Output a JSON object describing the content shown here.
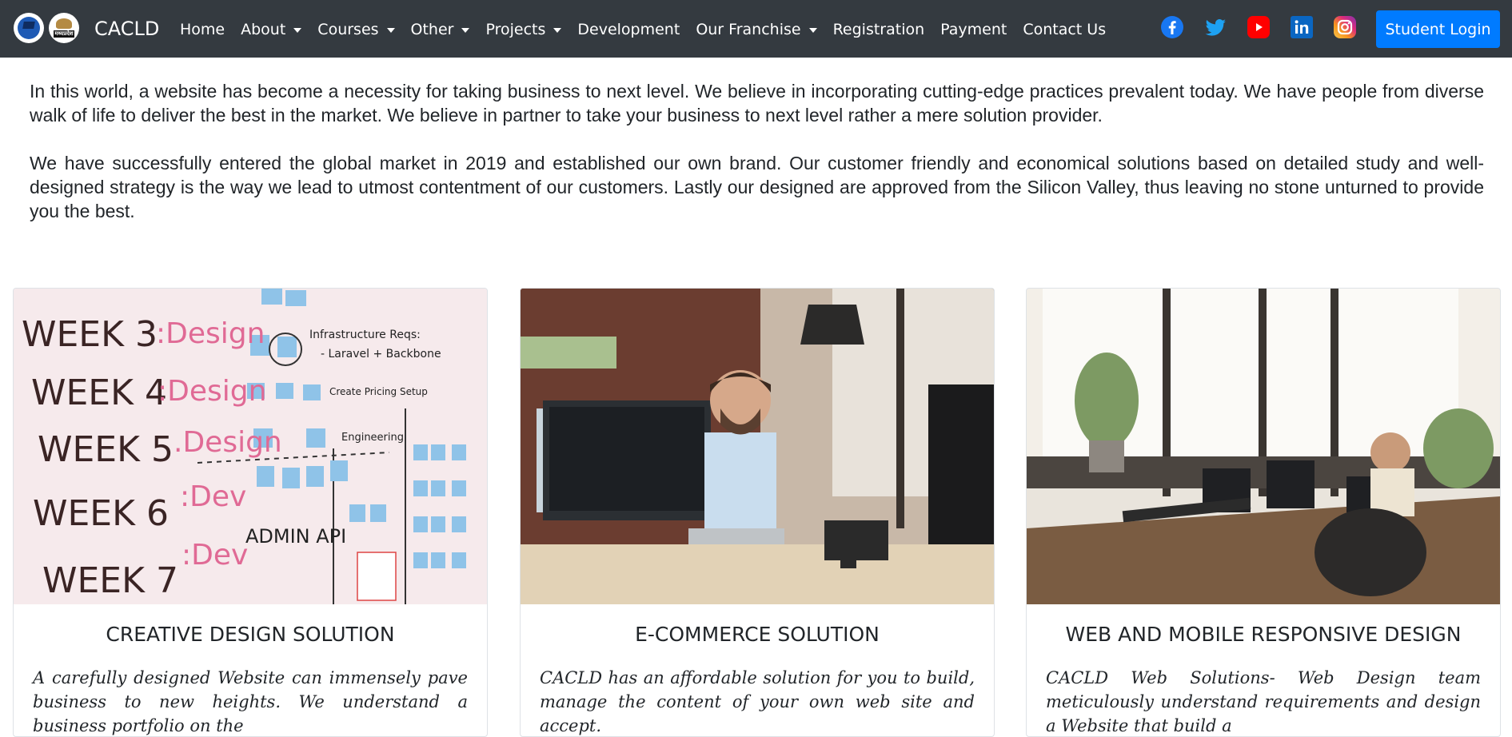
{
  "navbar": {
    "logos": {
      "second_logo_text": "मध्यप्रदेश"
    },
    "brand": "CACLD",
    "items": [
      {
        "label": "Home",
        "dropdown": false
      },
      {
        "label": "About",
        "dropdown": true
      },
      {
        "label": "Courses",
        "dropdown": true
      },
      {
        "label": "Other",
        "dropdown": true
      },
      {
        "label": "Projects",
        "dropdown": true
      },
      {
        "label": "Development",
        "dropdown": false
      },
      {
        "label": "Our Franchise",
        "dropdown": true
      },
      {
        "label": "Registration",
        "dropdown": false
      },
      {
        "label": "Payment",
        "dropdown": false
      },
      {
        "label": "Contact Us",
        "dropdown": false
      }
    ],
    "socials": [
      "facebook-icon",
      "twitter-icon",
      "youtube-icon",
      "linkedin-icon",
      "instagram-icon"
    ],
    "login_label": "Student Login"
  },
  "intro": {
    "p1": "In this world, a website has become a necessity for taking business to next level. We believe in incorporating cutting-edge practices prevalent today. We have people from diverse walk of life to deliver the best in the market. We believe in partner to take your business to next level rather a mere solution provider.",
    "p2": "We have successfully entered the global market in 2019 and established our own brand. Our customer friendly and economical solutions based on detailed study and well-designed strategy is the way we lead to utmost contentment of our customers. Lastly our designed are approved from the Silicon Valley, thus leaving no stone unturned to provide you the best."
  },
  "cards": [
    {
      "title": "CREATIVE DESIGN SOLUTION",
      "text": "A carefully designed Website can immensely pave business to new heights. We understand a business portfolio on the",
      "image": {
        "whiteboard_rows": [
          {
            "label": "WEEK 3",
            "tag": ":Design"
          },
          {
            "label": "WEEK 4",
            "tag": ":Design"
          },
          {
            "label": "WEEK 5",
            "tag": ".Design"
          },
          {
            "label": "WEEK 6",
            "tag": ":Dev"
          },
          {
            "label": "WEEK 7",
            "tag": ":Dev"
          }
        ],
        "notes": {
          "infra": "Infrastructure Reqs:",
          "infra2": "- Laravel + Backbone",
          "create": "Create Pricing Setup",
          "engineering": "Engineering",
          "admin": "ADMIN API"
        }
      }
    },
    {
      "title": "E-COMMERCE SOLUTION",
      "text": "CACLD has an affordable solution for you to build, manage the content of your own web site and accept."
    },
    {
      "title": "WEB AND MOBILE RESPONSIVE DESIGN",
      "text": "CACLD Web Solutions- Web Design team meticulously understand requirements and design a Website that build a"
    }
  ],
  "colors": {
    "navbar_bg": "#343a40",
    "primary": "#007bff"
  }
}
